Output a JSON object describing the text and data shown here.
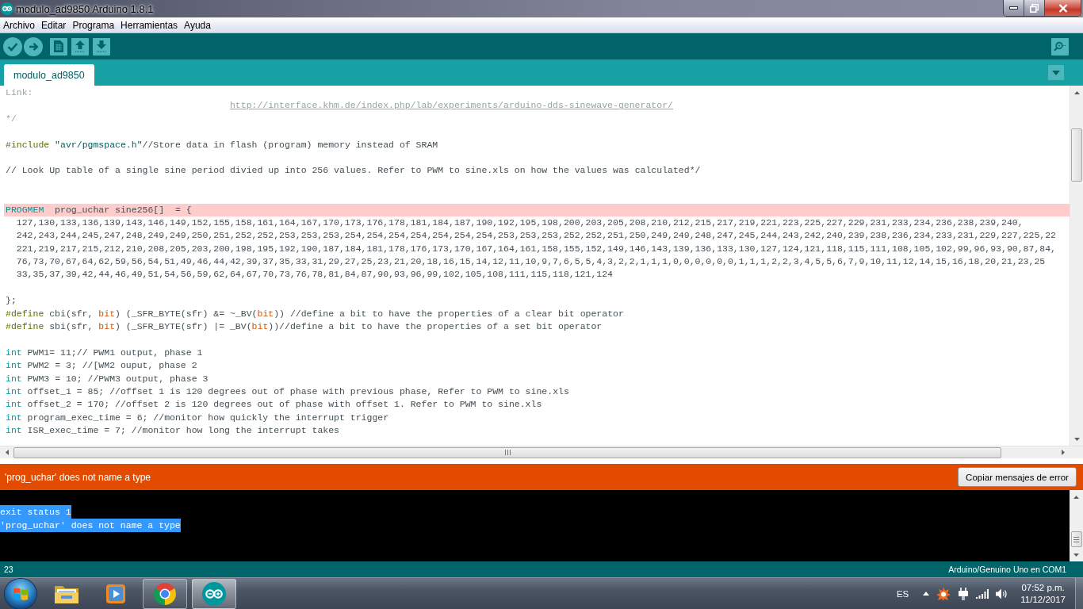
{
  "window": {
    "title": "modulo_ad9850 Arduino 1.8.1"
  },
  "menu": [
    "Archivo",
    "Editar",
    "Programa",
    "Herramientas",
    "Ayuda"
  ],
  "tabs": [
    {
      "label": "modulo_ad9850",
      "selected": true
    }
  ],
  "editor": {
    "lines": [
      {
        "highlighted": false,
        "tokens": [
          {
            "kind": "comment",
            "text": "Link:"
          }
        ]
      },
      {
        "highlighted": false,
        "tokens": [
          {
            "kind": "link",
            "text": "http://interface.khm.de/index.php/lab/experiments/arduino-dds-sinewave-generator/"
          }
        ]
      },
      {
        "highlighted": false,
        "tokens": [
          {
            "kind": "comment",
            "text": "*/"
          }
        ]
      },
      {
        "highlighted": false
      },
      {
        "highlighted": false,
        "tokens": [
          {
            "kind": "directive",
            "text": "#include"
          },
          {
            "kind": "string",
            "text": " \"avr/pgmspace.h\""
          },
          {
            "kind": "text",
            "text": "//Store data in flash (program) memory instead of SRAM"
          }
        ]
      },
      {
        "highlighted": false
      },
      {
        "highlighted": false,
        "tokens": [
          {
            "kind": "text",
            "text": "// Look Up table of a single sine period divied up into 256 values. Refer to PWM to sine.xls on how the values was calculated*/"
          }
        ]
      },
      {
        "highlighted": false
      },
      {
        "highlighted": false
      },
      {
        "highlighted": true,
        "tokens": [
          {
            "kind": "keyword",
            "text": "PROGMEM"
          },
          {
            "kind": "text",
            "text": "  prog_uchar sine256[]  = {"
          }
        ]
      },
      {
        "highlighted": false,
        "tokens": [
          {
            "kind": "text",
            "text": "  127,130,133,136,139,143,146,149,152,155,158,161,164,167,170,173,176,178,181,184,187,190,192,195,198,200,203,205,208,210,212,215,217,219,221,223,225,227,229,231,233,234,236,238,239,240,"
          }
        ]
      },
      {
        "highlighted": false,
        "tokens": [
          {
            "kind": "text",
            "text": "  242,243,244,245,247,248,249,249,250,251,252,252,253,253,253,254,254,254,254,254,254,254,253,253,253,252,252,251,250,249,249,248,247,245,244,243,242,240,239,238,236,234,233,231,229,227,225,22"
          }
        ]
      },
      {
        "highlighted": false,
        "tokens": [
          {
            "kind": "text",
            "text": "  221,219,217,215,212,210,208,205,203,200,198,195,192,190,187,184,181,178,176,173,170,167,164,161,158,155,152,149,146,143,139,136,133,130,127,124,121,118,115,111,108,105,102,99,96,93,90,87,84,"
          }
        ]
      },
      {
        "highlighted": false,
        "tokens": [
          {
            "kind": "text",
            "text": "  76,73,70,67,64,62,59,56,54,51,49,46,44,42,39,37,35,33,31,29,27,25,23,21,20,18,16,15,14,12,11,10,9,7,6,5,5,4,3,2,2,1,1,1,0,0,0,0,0,0,1,1,1,2,2,3,4,5,5,6,7,9,10,11,12,14,15,16,18,20,21,23,25"
          }
        ]
      },
      {
        "highlighted": false,
        "tokens": [
          {
            "kind": "text",
            "text": "  33,35,37,39,42,44,46,49,51,54,56,59,62,64,67,70,73,76,78,81,84,87,90,93,96,99,102,105,108,111,115,118,121,124"
          }
        ]
      },
      {
        "highlighted": false
      },
      {
        "highlighted": false,
        "tokens": [
          {
            "kind": "text",
            "text": "};"
          }
        ]
      },
      {
        "highlighted": false,
        "tokens": [
          {
            "kind": "directive",
            "text": "#define"
          },
          {
            "kind": "text",
            "text": " cbi(sfr, "
          },
          {
            "kind": "literal",
            "text": "bit"
          },
          {
            "kind": "text",
            "text": ") (_SFR_BYTE(sfr) &= ~_BV("
          },
          {
            "kind": "literal",
            "text": "bit"
          },
          {
            "kind": "text",
            "text": ")) //define a bit to have the properties of a clear bit operator"
          }
        ]
      },
      {
        "highlighted": false,
        "tokens": [
          {
            "kind": "directive",
            "text": "#define"
          },
          {
            "kind": "text",
            "text": " sbi(sfr, "
          },
          {
            "kind": "literal",
            "text": "bit"
          },
          {
            "kind": "text",
            "text": ") (_SFR_BYTE(sfr) |= _BV("
          },
          {
            "kind": "literal",
            "text": "bit"
          },
          {
            "kind": "text",
            "text": "))//define a bit to have the properties of a set bit operator"
          }
        ]
      },
      {
        "highlighted": false
      },
      {
        "highlighted": false,
        "tokens": [
          {
            "kind": "keyword",
            "text": "int"
          },
          {
            "kind": "text",
            "text": " PWM1= 11;// PWM1 output, phase 1"
          }
        ]
      },
      {
        "highlighted": false,
        "tokens": [
          {
            "kind": "keyword",
            "text": "int"
          },
          {
            "kind": "text",
            "text": " PWM2 = 3; //[WM2 ouput, phase 2"
          }
        ]
      },
      {
        "highlighted": false,
        "tokens": [
          {
            "kind": "keyword",
            "text": "int"
          },
          {
            "kind": "text",
            "text": " PWM3 = 10; //PWM3 output, phase 3"
          }
        ]
      },
      {
        "highlighted": false,
        "tokens": [
          {
            "kind": "keyword",
            "text": "int"
          },
          {
            "kind": "text",
            "text": " offset_1 = 85; //offset 1 is 120 degrees out of phase with previous phase, Refer to PWM to sine.xls"
          }
        ]
      },
      {
        "highlighted": false,
        "tokens": [
          {
            "kind": "keyword",
            "text": "int"
          },
          {
            "kind": "text",
            "text": " offset_2 = 170; //offset 2 is 120 degrees out of phase with offset 1. Refer to PWM to sine.xls"
          }
        ]
      },
      {
        "highlighted": false,
        "tokens": [
          {
            "kind": "keyword",
            "text": "int"
          },
          {
            "kind": "text",
            "text": " program_exec_time = 6; //monitor how quickly the interrupt trigger"
          }
        ]
      },
      {
        "highlighted": false,
        "tokens": [
          {
            "kind": "keyword",
            "text": "int"
          },
          {
            "kind": "text",
            "text": " ISR_exec_time = 7; //monitor how long the interrupt takes"
          }
        ]
      }
    ]
  },
  "error_bar": {
    "message": "'prog_uchar' does not name a type",
    "button": "Copiar mensajes de error"
  },
  "console": {
    "lines": [
      {
        "text": "exit status 1",
        "selected": true
      },
      {
        "text": "'prog_uchar' does not name a type",
        "selected": true
      }
    ]
  },
  "status_bar": {
    "line": "23",
    "board": "Arduino/Genuino Uno en COM1"
  },
  "taskbar": {
    "apps": [
      {
        "kind": "folder",
        "running": false,
        "selected": false
      },
      {
        "kind": "player",
        "running": false,
        "selected": false
      },
      {
        "kind": "browser",
        "running": true,
        "selected": false
      },
      {
        "kind": "arduino",
        "running": true,
        "selected": true
      }
    ],
    "language": "ES",
    "time": "07:52 p.m.",
    "date": "11/12/2017"
  }
}
